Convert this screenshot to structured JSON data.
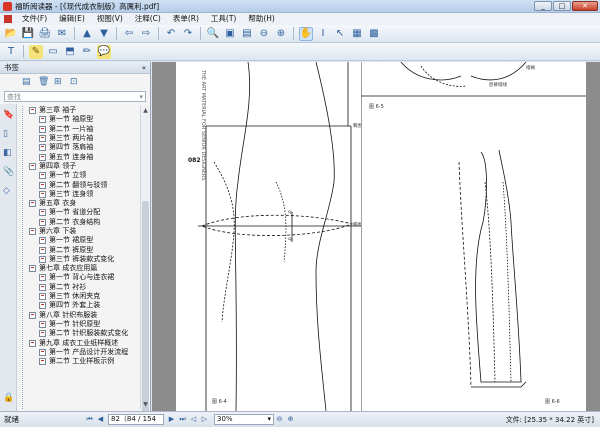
{
  "window": {
    "title": "福昕阅读器 - [《现代成衣制版》高厲利.pdf]",
    "minimize": "_",
    "maximize": "□",
    "close": "✕"
  },
  "menu": {
    "items": [
      "文件(F)",
      "编辑(E)",
      "视图(V)",
      "注释(C)",
      "表单(R)",
      "工具(T)",
      "帮助(H)"
    ]
  },
  "toolbar": {
    "row1_icons": [
      "open-folder-icon",
      "save-icon",
      "print-icon",
      "email-icon",
      "scroll-up-icon",
      "scroll-down-icon",
      "back-icon",
      "forward-icon",
      "undo-icon",
      "redo-icon",
      "zoom-icon",
      "fit-page-icon",
      "fit-width-icon",
      "zoom-out-icon",
      "zoom-in-icon",
      "hand-icon",
      "select-text-icon",
      "select-arrow-icon",
      "snapshot-icon",
      "image-icon"
    ],
    "row2_icons": [
      "typewriter-icon",
      "highlight-icon",
      "note-icon",
      "stamp-icon",
      "pencil-icon",
      "comment-icon"
    ]
  },
  "sidebar": {
    "title": "书签",
    "collapse": "«",
    "search_placeholder": "查找",
    "bookmarks": [
      "第三章 袖子",
      "第一节 袖原型",
      "第二节 一片袖",
      "第三节 两片袖",
      "第四节 落肩袖",
      "第五节 连身袖",
      "第四章 领子",
      "第一节 立领",
      "第二节 翻领与驳领",
      "第三节 连身领",
      "第五章 衣身",
      "第一节 省道分配",
      "第二节 衣身结构",
      "第六章 下装",
      "第一节 裙原型",
      "第二节 裤原型",
      "第三节 裤装款式变化",
      "第七章 成衣应用篇",
      "第一节 背心与连衣裙",
      "第二节 衬衫",
      "第三节 休闲夹克",
      "第四节 外套上装",
      "第八章 针织布服装",
      "第一节 针织原型",
      "第二节 针织服装款式变化",
      "第九章 成衣工业纸样概述",
      "第一节 产品设计开发流程",
      "第二节 工业样板示例"
    ]
  },
  "document": {
    "left_page": {
      "margin_text": "THE ART MATERIAL FOR SENIOR DESIGNERS",
      "page_number": "082",
      "anno_hip": "臀围线(HL)",
      "anno_knee": "膝围线(KL)",
      "anno_q1": "q₁",
      "anno_q2": "q₂",
      "caption": "图 6-4"
    },
    "right_page": {
      "anno_pleat": "褶裥",
      "anno_back": "后裤缝线",
      "caption_top": "图 6-5",
      "caption_bottom": "图 6-6"
    }
  },
  "status": {
    "ready": "就绪",
    "page_display": "82（84 / 154",
    "zoom": "30%",
    "doc_size": "文件: [25.35 * 34.22 英寸]"
  }
}
